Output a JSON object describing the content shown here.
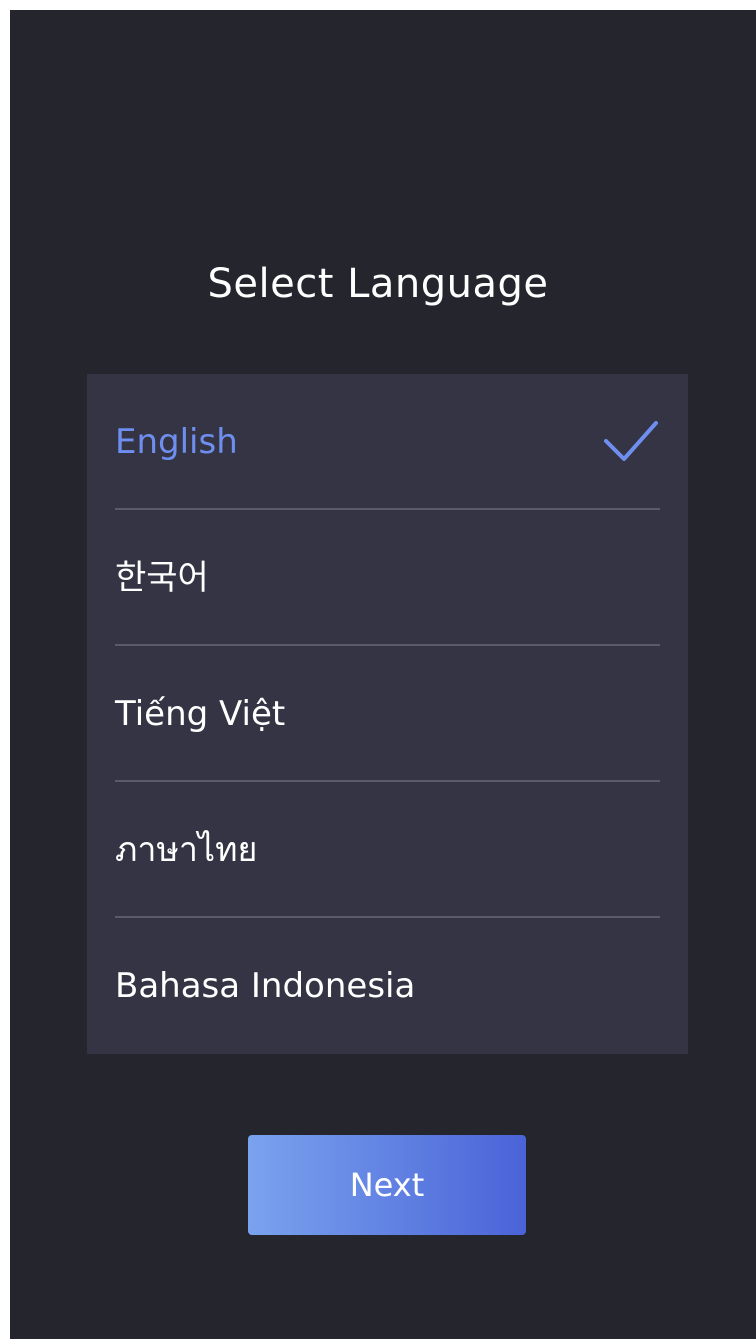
{
  "screen": {
    "title": "Select Language"
  },
  "languages": [
    {
      "label": "English",
      "selected": true
    },
    {
      "label": "한국어",
      "selected": false
    },
    {
      "label": "Tiếng Việt",
      "selected": false
    },
    {
      "label": "ภาษาไทย",
      "selected": false
    },
    {
      "label": "Bahasa Indonesia",
      "selected": false
    }
  ],
  "actions": {
    "next_label": "Next"
  },
  "colors": {
    "background": "#25252e",
    "panel": "#343444",
    "divider": "#5a5a6c",
    "accent": "#6f8ff0",
    "button_start": "#7aa3ee",
    "button_end": "#4a63d8"
  },
  "icons": {
    "selected_indicator": "check-icon"
  }
}
